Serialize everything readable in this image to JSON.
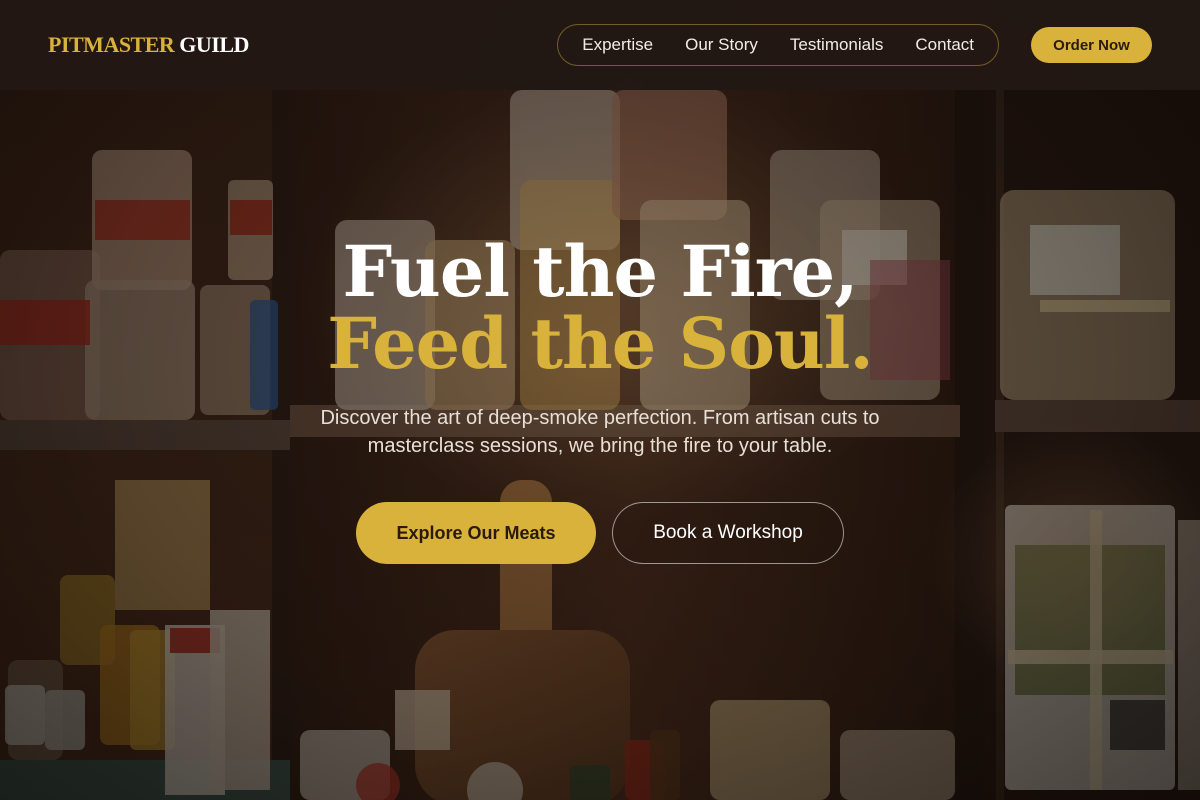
{
  "brand": {
    "name_part1": "PITMASTER",
    "name_part2": "GUILD"
  },
  "nav": {
    "items": [
      {
        "label": "Expertise"
      },
      {
        "label": "Our Story"
      },
      {
        "label": "Testimonials"
      },
      {
        "label": "Contact"
      }
    ],
    "order_label": "Order Now"
  },
  "hero": {
    "title_line1": "Fuel the Fire,",
    "title_line2": "Feed the Soul.",
    "subtitle": "Discover the art of deep-smoke perfection. From artisan cuts to masterclass sessions, we bring the fire to your table.",
    "primary_cta": "Explore Our Meats",
    "secondary_cta": "Book a Workshop"
  },
  "colors": {
    "accent": "#d9b23b",
    "header_bg": "#221814",
    "text_light": "#ffffff"
  }
}
